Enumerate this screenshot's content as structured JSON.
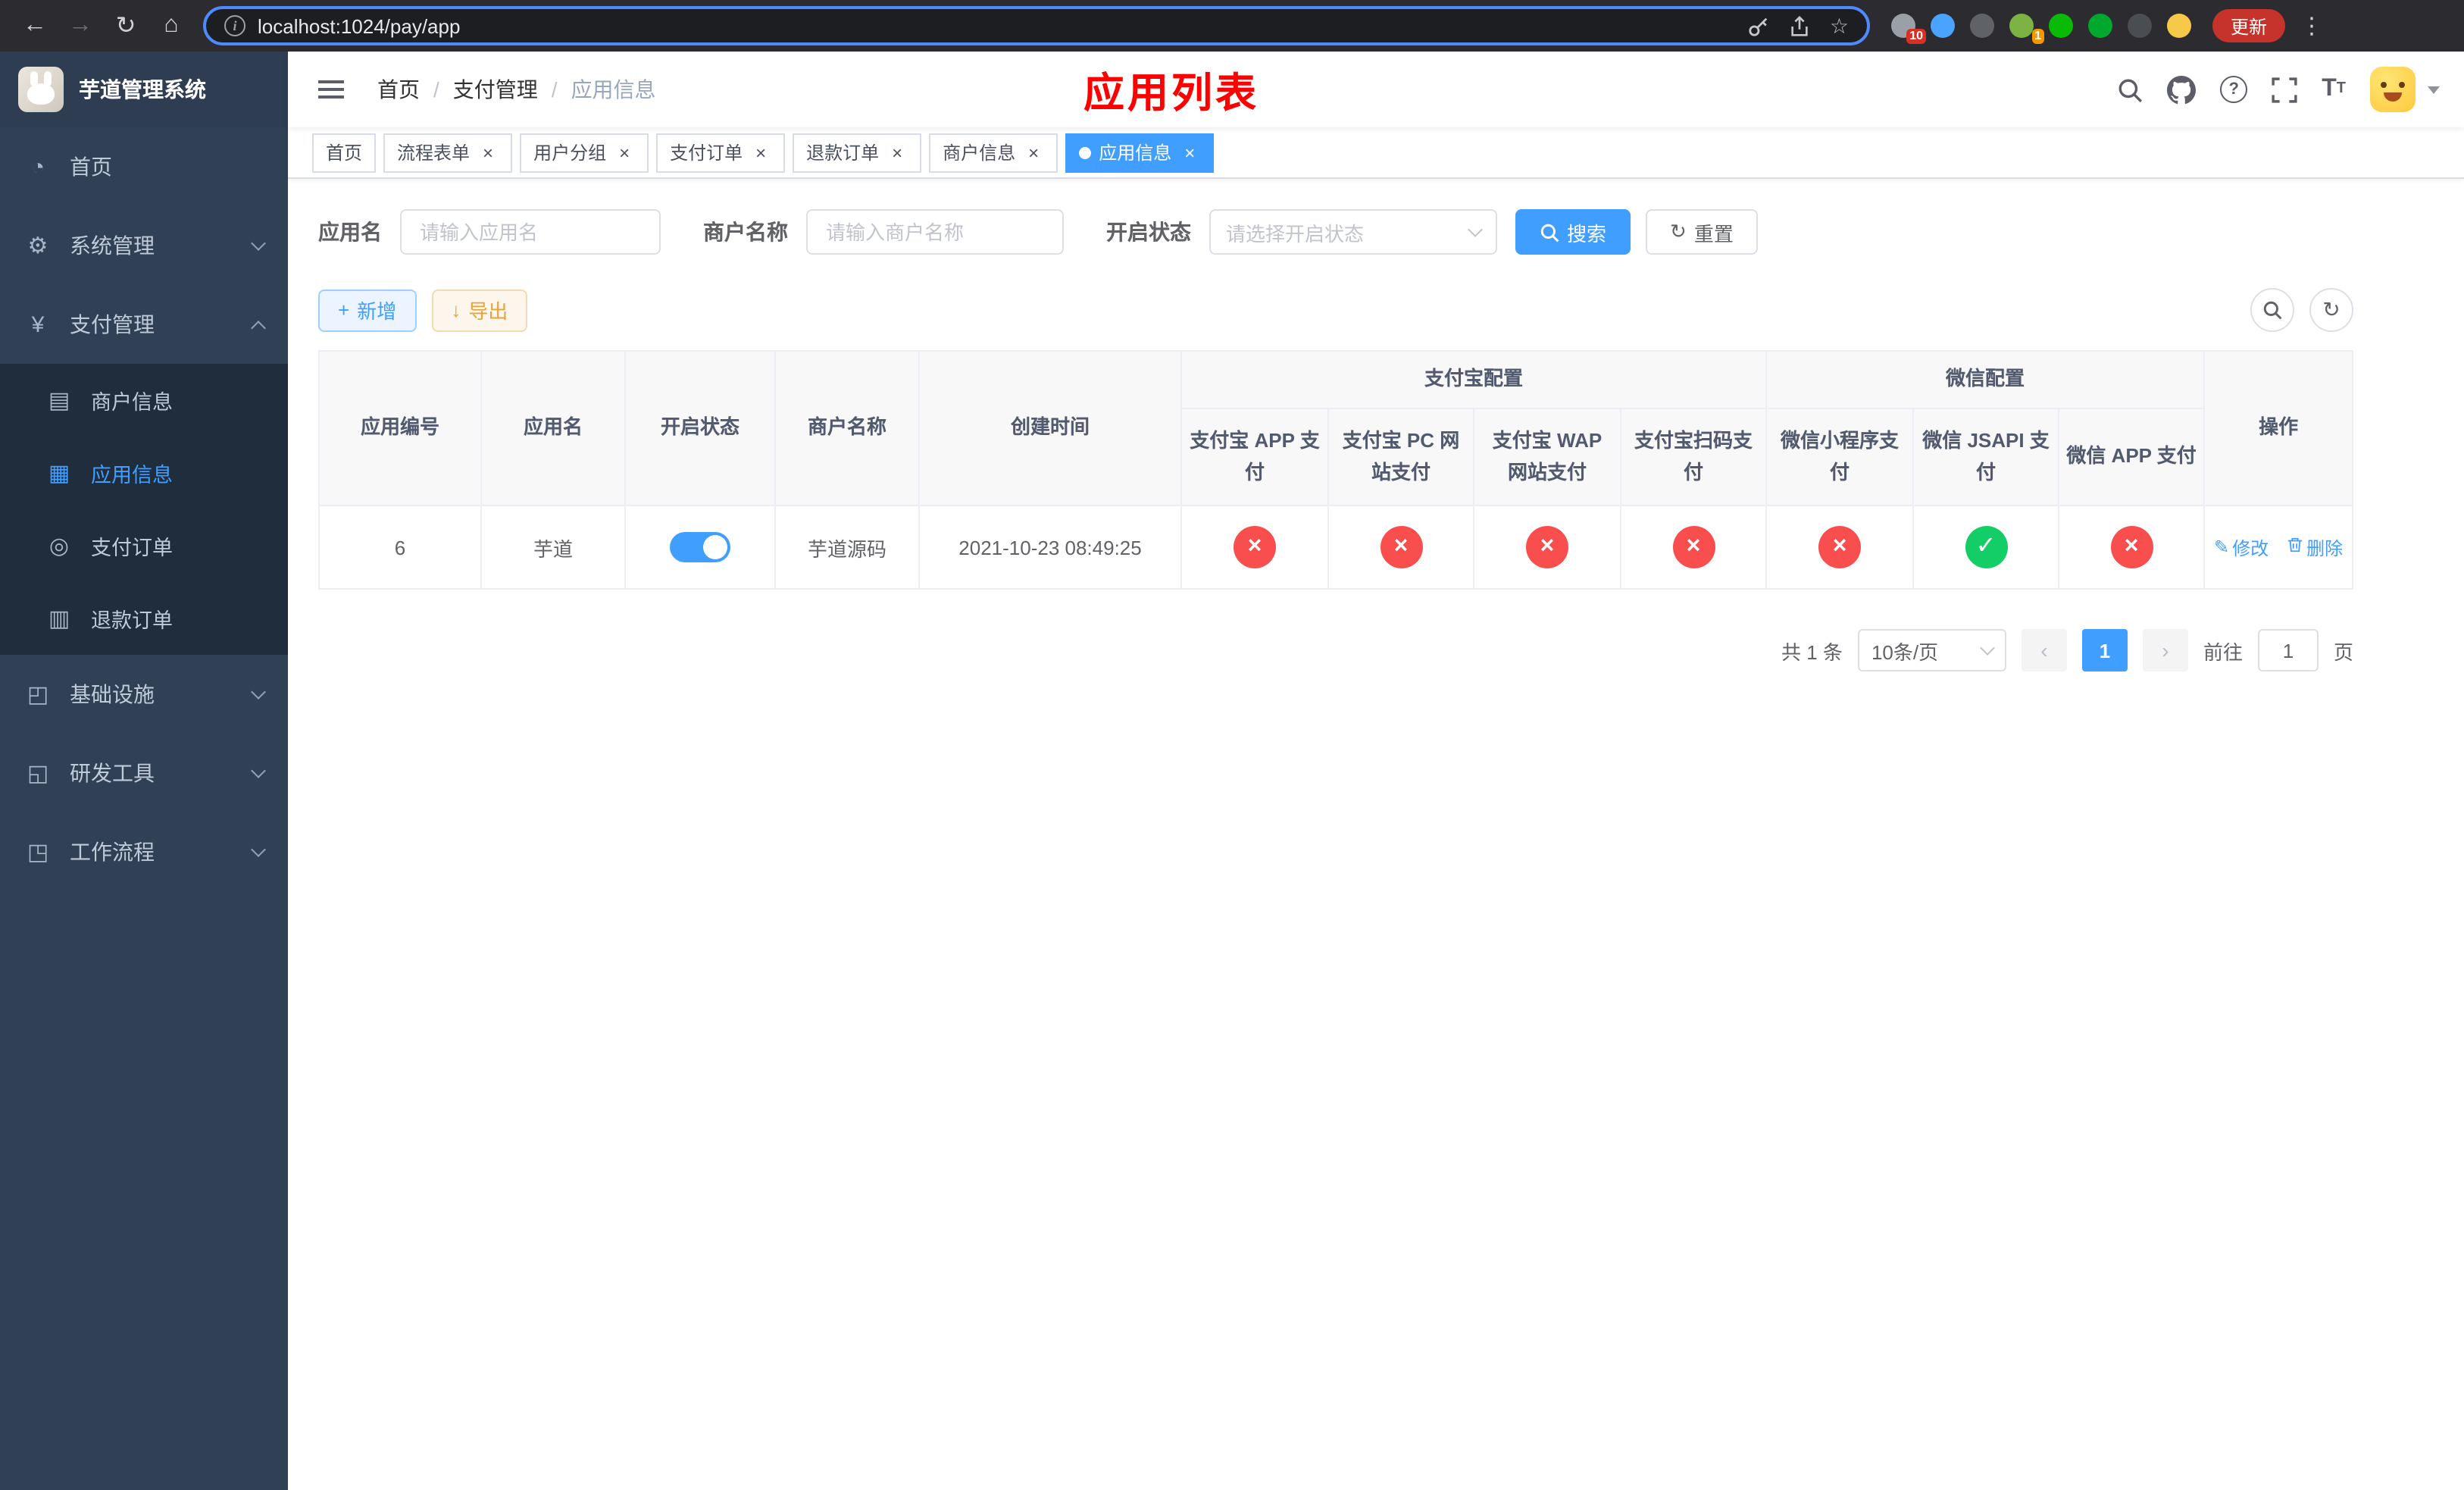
{
  "colors": {
    "primary": "#409eff",
    "success": "#13ce66",
    "danger": "#f84e4e",
    "warning": "#e6a23c",
    "page_title_red": "#ff0000",
    "sidebar_bg": "#304156",
    "submenu_bg": "#1f2d3d",
    "update_button_red": "#c5332c"
  },
  "browser": {
    "url": "localhost:1024/pay/app",
    "update_label": "更新",
    "extensions": [
      {
        "name": "puzzle",
        "color": "#9aa0a6",
        "badge": "10",
        "badge_color": "#d93025"
      },
      {
        "name": "drop",
        "color": "#4aa3ff",
        "badge": "",
        "badge_color": ""
      },
      {
        "name": "dark-circle",
        "color": "#5f6368",
        "badge": "",
        "badge_color": ""
      },
      {
        "name": "green-camera",
        "color": "#7cb342",
        "badge": "1",
        "badge_color": "#f29900"
      },
      {
        "name": "wechat",
        "color": "#09bb07",
        "badge": "",
        "badge_color": ""
      },
      {
        "name": "evernote",
        "color": "#00a82d",
        "badge": "",
        "badge_color": ""
      },
      {
        "name": "pin",
        "color": "#4a4d51",
        "badge": "",
        "badge_color": ""
      },
      {
        "name": "face",
        "color": "#f7c948",
        "badge": "",
        "badge_color": ""
      }
    ]
  },
  "sidebar": {
    "title": "芋道管理系统",
    "menu": [
      {
        "name": "home",
        "label": "首页",
        "icon": "dashboard-icon",
        "glyph": "◔",
        "type": "item",
        "expanded": false
      },
      {
        "name": "system-management",
        "label": "系统管理",
        "icon": "gear-icon",
        "glyph": "⚙",
        "type": "parent",
        "expanded": false
      },
      {
        "name": "payment-management",
        "label": "支付管理",
        "icon": "yen-icon",
        "glyph": "¥",
        "type": "parent",
        "expanded": true,
        "children": [
          {
            "name": "merchant-info",
            "label": "商户信息",
            "icon": "card-icon",
            "glyph": "▤",
            "active": false
          },
          {
            "name": "app-info",
            "label": "应用信息",
            "icon": "grid-icon",
            "glyph": "▦",
            "active": true
          },
          {
            "name": "payment-orders",
            "label": "支付订单",
            "icon": "order-icon",
            "glyph": "◎",
            "active": false
          },
          {
            "name": "refund-orders",
            "label": "退款订单",
            "icon": "refund-icon",
            "glyph": "▥",
            "active": false
          }
        ]
      },
      {
        "name": "infrastructure",
        "label": "基础设施",
        "icon": "infra-icon",
        "glyph": "◰",
        "type": "parent",
        "expanded": false
      },
      {
        "name": "dev-tools",
        "label": "研发工具",
        "icon": "tools-icon",
        "glyph": "◱",
        "type": "parent",
        "expanded": false
      },
      {
        "name": "workflow",
        "label": "工作流程",
        "icon": "workflow-icon",
        "glyph": "◳",
        "type": "parent",
        "expanded": false
      }
    ]
  },
  "navbar": {
    "breadcrumb": [
      "首页",
      "支付管理",
      "应用信息"
    ],
    "page_title": "应用列表"
  },
  "tabs": [
    {
      "name": "home",
      "label": "首页",
      "closable": false,
      "active": false
    },
    {
      "name": "process-form",
      "label": "流程表单",
      "closable": true,
      "active": false
    },
    {
      "name": "user-group",
      "label": "用户分组",
      "closable": true,
      "active": false
    },
    {
      "name": "payment-orders",
      "label": "支付订单",
      "closable": true,
      "active": false
    },
    {
      "name": "refund-orders",
      "label": "退款订单",
      "closable": true,
      "active": false
    },
    {
      "name": "merchant-info",
      "label": "商户信息",
      "closable": true,
      "active": false
    },
    {
      "name": "app-info",
      "label": "应用信息",
      "closable": true,
      "active": true
    }
  ],
  "filters": {
    "app_name_label": "应用名",
    "app_name_placeholder": "请输入应用名",
    "merchant_label": "商户名称",
    "merchant_placeholder": "请输入商户名称",
    "status_label": "开启状态",
    "status_placeholder": "请选择开启状态",
    "search_label": "搜索",
    "reset_label": "重置"
  },
  "toolbar": {
    "add_label": "新增",
    "export_label": "导出"
  },
  "table": {
    "fixed_columns": [
      "应用编号",
      "应用名",
      "开启状态",
      "商户名称",
      "创建时间"
    ],
    "alipay_group": "支付宝配置",
    "wechat_group": "微信配置",
    "alipay_columns": [
      "支付宝 APP 支付",
      "支付宝 PC 网站支付",
      "支付宝 WAP 网站支付",
      "支付宝扫码支付"
    ],
    "wechat_columns": [
      "微信小程序支付",
      "微信 JSAPI 支付",
      "微信 APP 支付"
    ],
    "op_column": "操作",
    "rows": [
      {
        "id": "6",
        "app_name": "芋道",
        "status_on": true,
        "merchant_name": "芋道源码",
        "create_time": "2021-10-23 08:49:25",
        "configs": [
          "no",
          "no",
          "no",
          "no",
          "no",
          "yes",
          "no"
        ],
        "edit_label": "修改",
        "delete_label": "删除"
      }
    ]
  },
  "pagination": {
    "total_text": "共 1 条",
    "page_size": "10条/页",
    "current_page": "1",
    "goto_label": "前往",
    "goto_value": "1",
    "page_unit": "页"
  }
}
